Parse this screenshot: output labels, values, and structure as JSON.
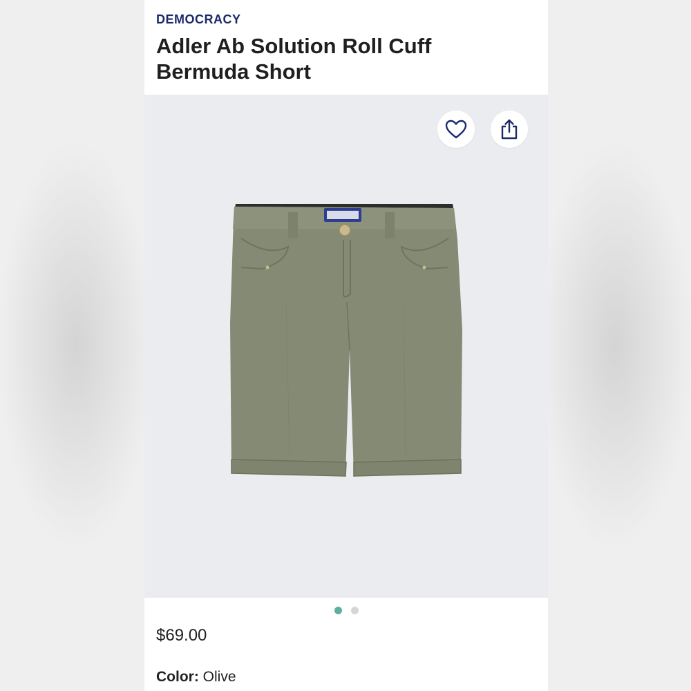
{
  "product": {
    "brand": "DEMOCRACY",
    "title": "Adler Ab Solution Roll Cuff Bermuda Short",
    "price": "$69.00",
    "color_label": "Color:",
    "color_value": "Olive"
  },
  "gallery": {
    "icons": {
      "favorite": "heart-icon",
      "share": "share-icon"
    },
    "image_count": 2,
    "active_index": 0
  },
  "colors": {
    "brand": "#1c2a6b",
    "accent_dot": "#5cae9f",
    "garment": "#848a74"
  }
}
